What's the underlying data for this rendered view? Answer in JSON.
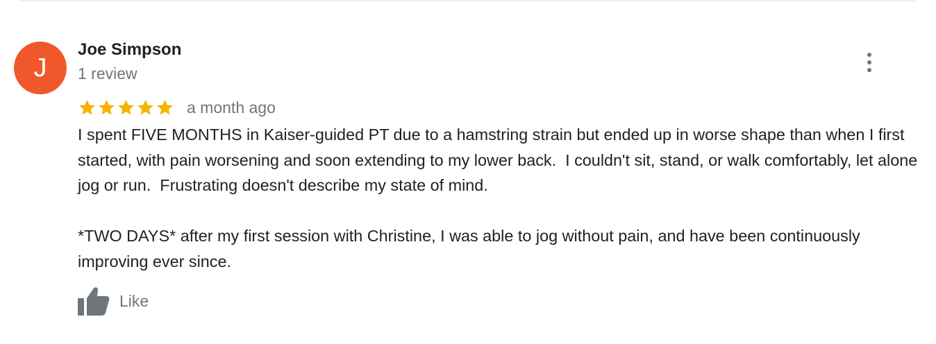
{
  "review": {
    "avatar_letter": "J",
    "avatar_color": "#f0582b",
    "reviewer_name": "Joe Simpson",
    "review_count": "1 review",
    "rating": 5,
    "rating_max": 5,
    "star_color": "#f4b400",
    "time_ago": "a month ago",
    "paragraphs": [
      "I spent FIVE MONTHS in Kaiser-guided PT due to a hamstring strain but ended up in worse shape than when I first started, with pain worsening and soon extending to my lower back.  I couldn't sit, stand, or walk comfortably, let alone jog or run.  Frustrating doesn't describe my state of mind.",
      "*TWO DAYS* after my first session with Christine, I was able to jog without pain, and have been continuously improving ever since."
    ],
    "like_label": "Like",
    "icons": {
      "more": "more-vert-icon",
      "like": "thumbs-up-icon",
      "star": "star-icon"
    }
  }
}
